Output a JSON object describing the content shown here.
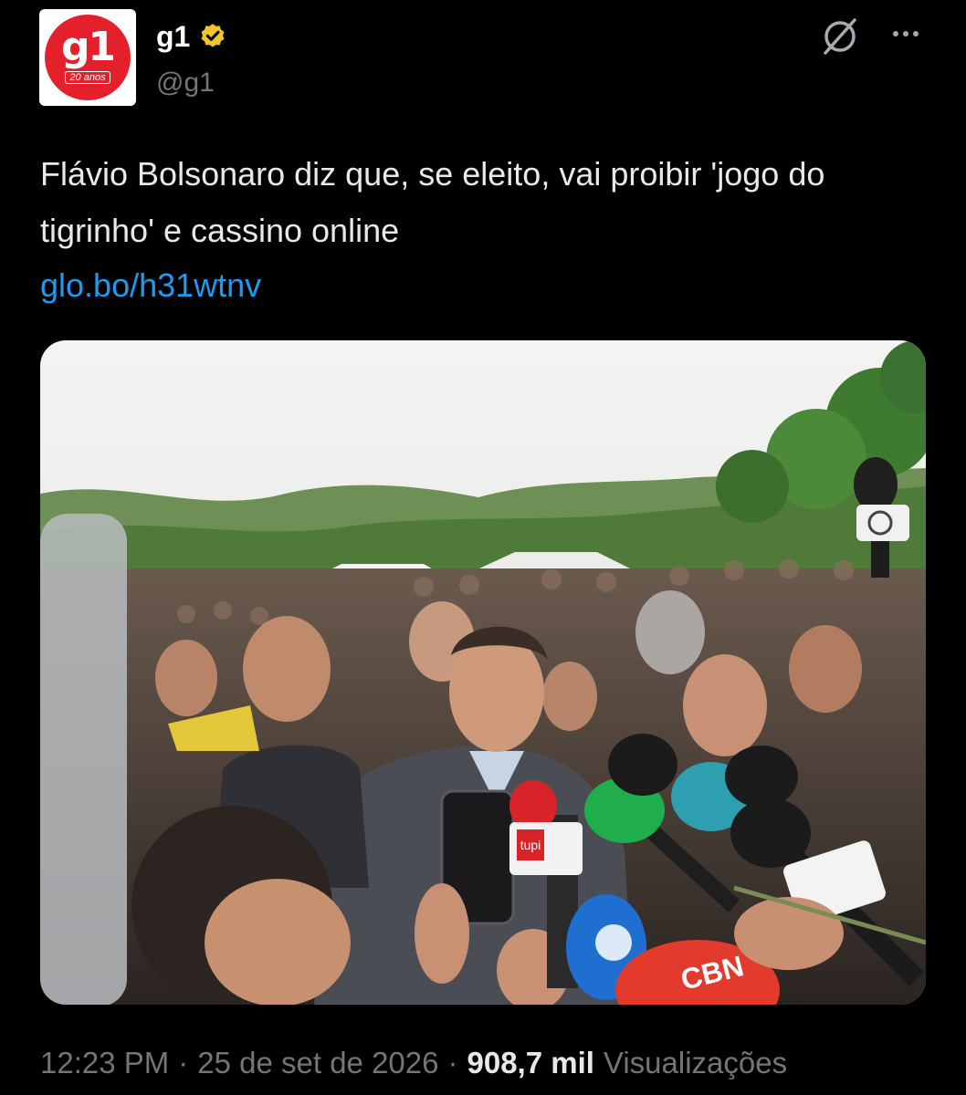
{
  "account": {
    "display_name": "g1",
    "handle": "@g1",
    "avatar_logo": "g1",
    "avatar_sub": "20 anos",
    "verified": true,
    "verified_color": "#f4c430",
    "avatar_color": "#e5202d"
  },
  "header_icons": {
    "grok": "grok-icon",
    "more": "more-icon"
  },
  "tweet": {
    "text": "Flávio Bolsonaro diz que, se eleito, vai proibir 'jogo do tigrinho' e cassino online",
    "link": "glo.bo/h31wtnv",
    "link_color": "#1d9bf0"
  },
  "media": {
    "mic_labels": {
      "tupi": "tupi",
      "cbn": "CBN"
    }
  },
  "meta": {
    "time": "12:23 PM",
    "separator": "·",
    "date": "25 de set de 2026",
    "views_count": "908,7 mil",
    "views_label": "Visualizações"
  }
}
